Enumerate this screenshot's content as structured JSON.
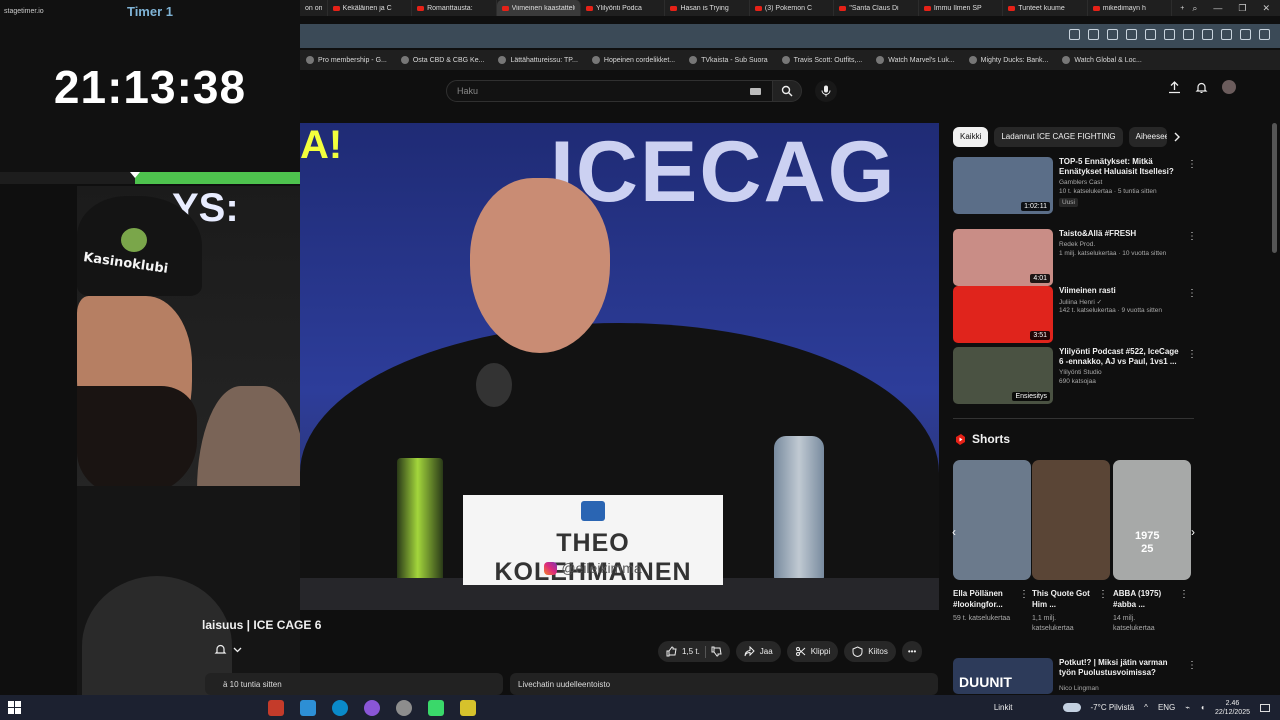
{
  "timer": {
    "brand": "stagetimer.io",
    "title": "Timer 1",
    "time": "21:13:38",
    "elapsed_fraction": 0.45
  },
  "browser": {
    "tabs": [
      "on one",
      "Kekäläinen ja C",
      "Romanttausta:",
      "Viimeinen kaastattelu",
      "Ylilyönti Podca",
      "Hasan is Trying",
      "(3) Pokemon C",
      "\"Santa Claus Di",
      "Immu Ilmen SP",
      "Tunteet kuume",
      "mikedimayn h"
    ],
    "active_tab_index": 3,
    "bookmarks": [
      "Pro membership - G...",
      "Osta CBD & CBG Ke...",
      "Lättähattureissu: TP...",
      "Hopeinen cordelikket...",
      "TVkaista - Sub Suora",
      "Travis Scott: Outfits,...",
      "Watch Marvel's Luk...",
      "Mighty Ducks: Bank...",
      "Watch Global & Loc..."
    ]
  },
  "youtube": {
    "search_placeholder": "Haku",
    "video": {
      "banner_fragment": "A!",
      "banner_fragment2": "YS:",
      "backdrop_text": "ICECAG",
      "nameplate_name": "THEO KOLEHMAINEN",
      "nameplate_handle": "@eileikimma",
      "title_fragment": "laisuus | ICE CAGE 6",
      "posted": "ä 10 tuntia sitten",
      "likes": "1,5 t.",
      "share": "Jaa",
      "clip": "Klippi",
      "thanks": "Kiitos",
      "chat_replay": "Livechatin uudelleentoisto"
    },
    "chips": [
      "Kaikki",
      "Ladannut ICE CAGE FIGHTING",
      "Aiheeseen liittyvät"
    ],
    "recommendations": [
      {
        "title": "TOP-5 Ennätykset: Mitkä Ennätykset Haluaisit Itsellesi?",
        "channel": "Gamblers Cast",
        "meta": "10 t. katselukertaa · 5 tuntia sitten",
        "badge": "Uusi",
        "duration": "1:02:11",
        "color": "#5b6e88"
      },
      {
        "title": "Taisto&Allä #FRESH",
        "channel": "Redek Prod.",
        "meta": "1 milj. katselukertaa · 10 vuotta sitten",
        "badge": "",
        "duration": "4:01",
        "color": "#c98d86"
      },
      {
        "title": "Viimeinen rasti",
        "channel": "Juliina Henri ✓",
        "meta": "142 t. katselukertaa · 9 vuotta sitten",
        "badge": "",
        "duration": "3:51",
        "color": "#e0241c"
      },
      {
        "title": "Ylilyönti Podcast #522, IceCage 6 -ennakko, AJ vs Paul, 1vs1 ...",
        "channel": "Ylilyönti Studio",
        "meta": "690 katsojaa",
        "badge": "",
        "duration": "Ensiesitys",
        "color": "#4a5242"
      }
    ],
    "shorts_heading": "Shorts",
    "shorts": [
      {
        "title": "Ella Pöllänen #lookingfor...",
        "views": "59 t. katselukertaa",
        "color": "#6b7a8c"
      },
      {
        "title": "This Quote Got Him ...",
        "views": "1,1 milj. katselukertaa",
        "color": "#5a4536"
      },
      {
        "title": "ABBA (1975) #abba ...",
        "views": "14 milj. katselukertaa",
        "color": "#a7a9a8"
      }
    ],
    "short_overlay": "1975\n25",
    "bottom_rec": {
      "title": "Potkut!? | Miksi jätin varman työn Puolustusvoimissa?",
      "channel": "Nico Lingman",
      "thumb_text": "DUUNIT"
    }
  },
  "taskbar": {
    "links": "Linkit",
    "weather": "-7°C Pilvistä",
    "lang": "ENG",
    "time": "2.46",
    "date": "22/12/2025"
  }
}
